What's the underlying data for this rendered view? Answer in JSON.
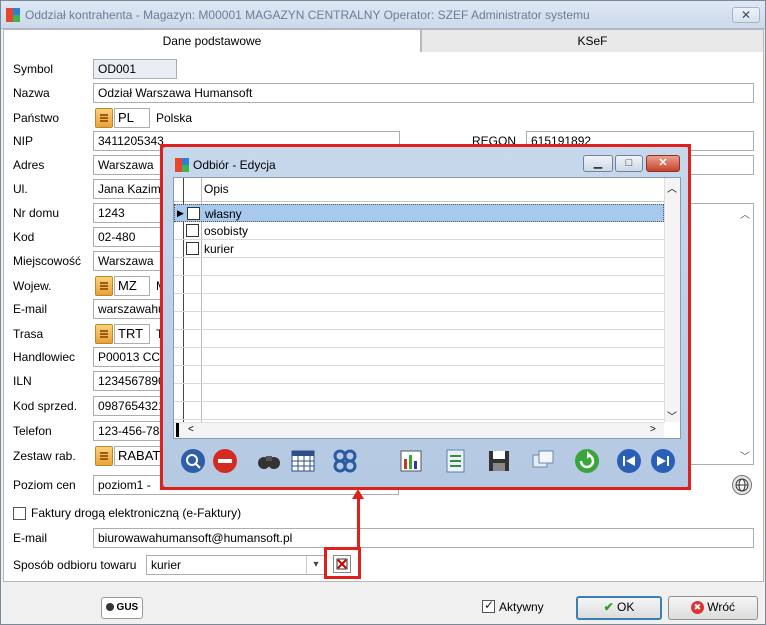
{
  "window": {
    "title": "Oddział kontrahenta - Magazyn: M00001 MAGAZYN CENTRALNY  Operator:  SZEF Administrator systemu",
    "close_glyph": "✕"
  },
  "tabs": [
    "Dane podstawowe",
    "KSeF"
  ],
  "form": {
    "symbol_label": "Symbol",
    "symbol_value": "OD001",
    "nazwa_label": "Nazwa",
    "nazwa_value": "Odział Warszawa Humansoft",
    "panstwo_label": "Państwo",
    "panstwo_code": "PL",
    "panstwo_name": "Polska",
    "nip_label": "NIP",
    "nip_value": "3411205343",
    "regon_label": "REGON",
    "regon_value": "615191892",
    "adres_label": "Adres",
    "adres_value": "Warszawa",
    "ul_label": "Ul.",
    "ul_value": "Jana Kazim",
    "nrdomu_label": "Nr domu",
    "nrdomu_value": "1243",
    "kod_label": "Kod",
    "kod_value": "02-480",
    "miejscowosc_label": "Miejscowość",
    "miejscowosc_value": "Warszawa",
    "wojew_label": "Wojew.",
    "wojew_code": "MZ",
    "wojew_name": "M",
    "email_label": "E-mail",
    "email_value": "warszawahu",
    "trasa_label": "Trasa",
    "trasa_code": "TRT",
    "trasa_name": "T",
    "handlowiec_label": "Handlowiec",
    "handlowiec_value": "P00013 CC",
    "iln_label": "ILN",
    "iln_value": "1234567890",
    "kodsprzed_label": "Kod sprzed.",
    "kodsprzed_value": "0987654321",
    "telefon_label": "Telefon",
    "telefon_value": "123-456-789",
    "zestaw_label": "Zestaw rab.",
    "zestaw_code": "RABAT",
    "poziom_label": "Poziom cen",
    "poziom_value": "poziom1 - ",
    "efaktury_label": "Faktury drogą elektroniczną (e-Faktury)",
    "email2_label": "E-mail",
    "email2_value": "biurowawahumansoft@humansoft.pl",
    "sposob_label": "Sposób odbioru towaru",
    "sposob_value": "kurier"
  },
  "footer": {
    "gus_label": "GUS",
    "aktywny_label": "Aktywny",
    "ok_label": "OK",
    "wroc_label": "Wróć"
  },
  "dialog": {
    "title": "Odbiór - Edycja",
    "column_header": "Opis",
    "rows": [
      "własny",
      "osobisty",
      "kurier"
    ]
  },
  "colors": {
    "highlight": "#e0201c",
    "selection": "#a8c9ee"
  }
}
